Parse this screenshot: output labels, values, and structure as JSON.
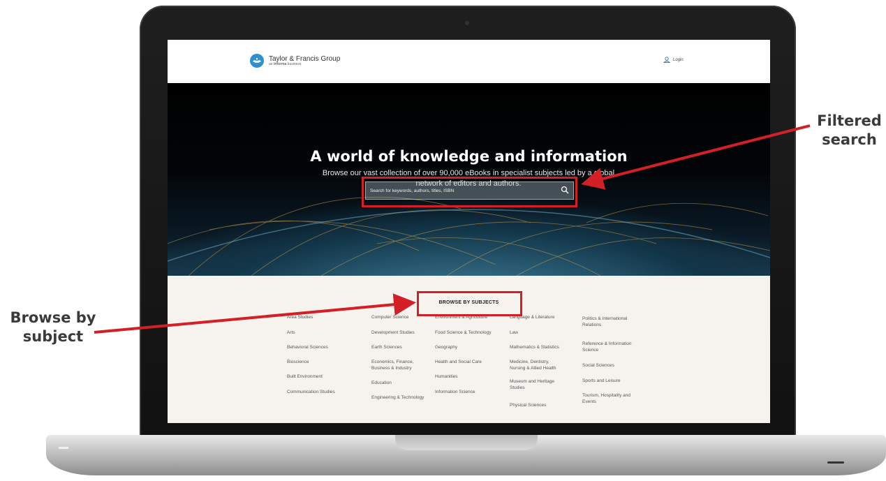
{
  "site": {
    "logo_title": "Taylor & Francis Group",
    "logo_sub_pre": "an ",
    "logo_sub_bold": "informa",
    "logo_sub_post": " business",
    "login_label": "Login"
  },
  "hero": {
    "title": "A world of knowledge and information",
    "subtitle": "Browse our vast collection of over 90,000 eBooks in specialist subjects led by a global network of editors and authors.",
    "search_placeholder": "Search for keywords, authors, titles, ISBN"
  },
  "subjects": {
    "heading": "BROWSE BY SUBJECTS",
    "columns": [
      [
        "Area Studies",
        "Arts",
        "Behavioral Sciences",
        "Bioscience",
        "Built Environment",
        "Communication Studies"
      ],
      [
        "Computer Science",
        "Development Studies",
        "Earth Sciences",
        "Economics, Finance, Business & Industry",
        "Education",
        "Engineering & Technology"
      ],
      [
        "Environment & Agriculture",
        "Food Science & Technology",
        "Geography",
        "Health and Social Care",
        "Humanities",
        "Information Science"
      ],
      [
        "Language & Literature",
        "Law",
        "Mathematics & Statistics",
        "Medicine, Dentistry, Nursing & Allied Health",
        "Museum and Heritage Studies",
        "Physical Sciences"
      ],
      [
        "Politics & International Relations",
        "Reference & Information Science",
        "Social Sciences",
        "Sports and Leisure",
        "Tourism, Hospitality and Events"
      ]
    ]
  },
  "annotations": {
    "filtered_search": [
      "Filtered",
      "search"
    ],
    "browse_by_subject": [
      "Browse by",
      "subject"
    ],
    "color": "#d32027"
  }
}
